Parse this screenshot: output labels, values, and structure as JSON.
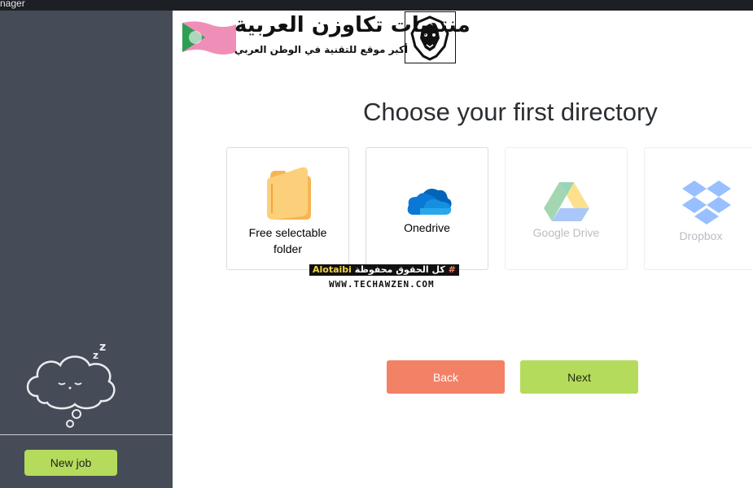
{
  "window": {
    "title_fragment": "nager"
  },
  "sidebar": {
    "new_job_label": "New job"
  },
  "main": {
    "heading": "Choose your first directory",
    "options": [
      {
        "label": "Free selectable folder",
        "icon": "folder-icon",
        "enabled": true
      },
      {
        "label": "Onedrive",
        "icon": "onedrive-icon",
        "enabled": true
      },
      {
        "label": "Google Drive",
        "icon": "google-drive-icon",
        "enabled": false
      },
      {
        "label": "Dropbox",
        "icon": "dropbox-icon",
        "enabled": false
      }
    ],
    "back_label": "Back",
    "next_label": "Next"
  },
  "watermark": {
    "title": "منتديات تكاوزن العربية",
    "subtitle": "أكبر موقع للتقنية في الوطن العربي",
    "credit_hash": "#",
    "credit_text": "كل الحقوق محفوظة",
    "credit_name": "Alotaibi",
    "site": "WWW.TECHAWZEN.COM"
  },
  "colors": {
    "sidebar": "#454c57",
    "accent_green": "#b5db5c",
    "back_button": "#f38166",
    "titlebar": "#1c1f24"
  }
}
